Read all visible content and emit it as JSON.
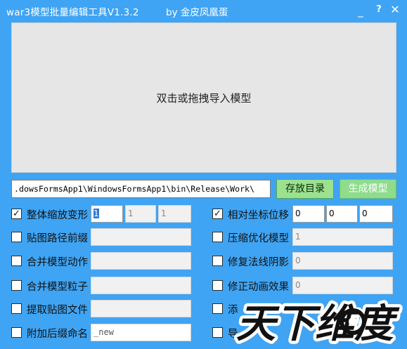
{
  "window": {
    "title": "war3模型批量编辑工具V1.3.2",
    "author": "by 金皮凤凰蛋",
    "minimize_glyph": "_",
    "help_glyph": "?",
    "close_glyph": "✕"
  },
  "drop_zone": {
    "text": "双击或拖拽导入模型"
  },
  "output": {
    "path": ".dowsFormsApp1\\WindowsFormsApp1\\bin\\Release\\Work\\",
    "save_dir_label": "存放目录",
    "generate_label": "生成模型"
  },
  "left_options": [
    {
      "label": "整体缩放变形",
      "checked": true,
      "fields": [
        "1",
        "1",
        "1"
      ]
    },
    {
      "label": "贴图路径前缀",
      "checked": false,
      "fields": [
        ""
      ]
    },
    {
      "label": "合并模型动作",
      "checked": false,
      "fields": [
        ""
      ]
    },
    {
      "label": "合并模型粒子",
      "checked": false,
      "fields": [
        ""
      ]
    },
    {
      "label": "提取贴图文件",
      "checked": false,
      "fields": [
        ""
      ]
    },
    {
      "label": "附加后缀命名",
      "checked": false,
      "fields": [
        "_new"
      ]
    }
  ],
  "right_options": [
    {
      "label": "相对坐标位移",
      "checked": true,
      "fields": [
        "0",
        "0",
        "0"
      ]
    },
    {
      "label": "压缩优化模型",
      "checked": false,
      "fields": [
        "1"
      ]
    },
    {
      "label": "修复法线阴影",
      "checked": false,
      "fields": [
        "0"
      ]
    },
    {
      "label": "修正动画效果",
      "checked": false,
      "fields": [
        "0"
      ]
    },
    {
      "label": "添",
      "checked": false,
      "fields": []
    },
    {
      "label": "导",
      "checked": false,
      "fields": []
    }
  ],
  "check_glyph": "✓",
  "watermark": {
    "text": "天下维度"
  },
  "colors": {
    "window_bg": "#3fa4f3",
    "drop_zone_bg": "#e6e6e6",
    "save_button": "#9ce18e",
    "generate_button": "#8edc8c"
  }
}
